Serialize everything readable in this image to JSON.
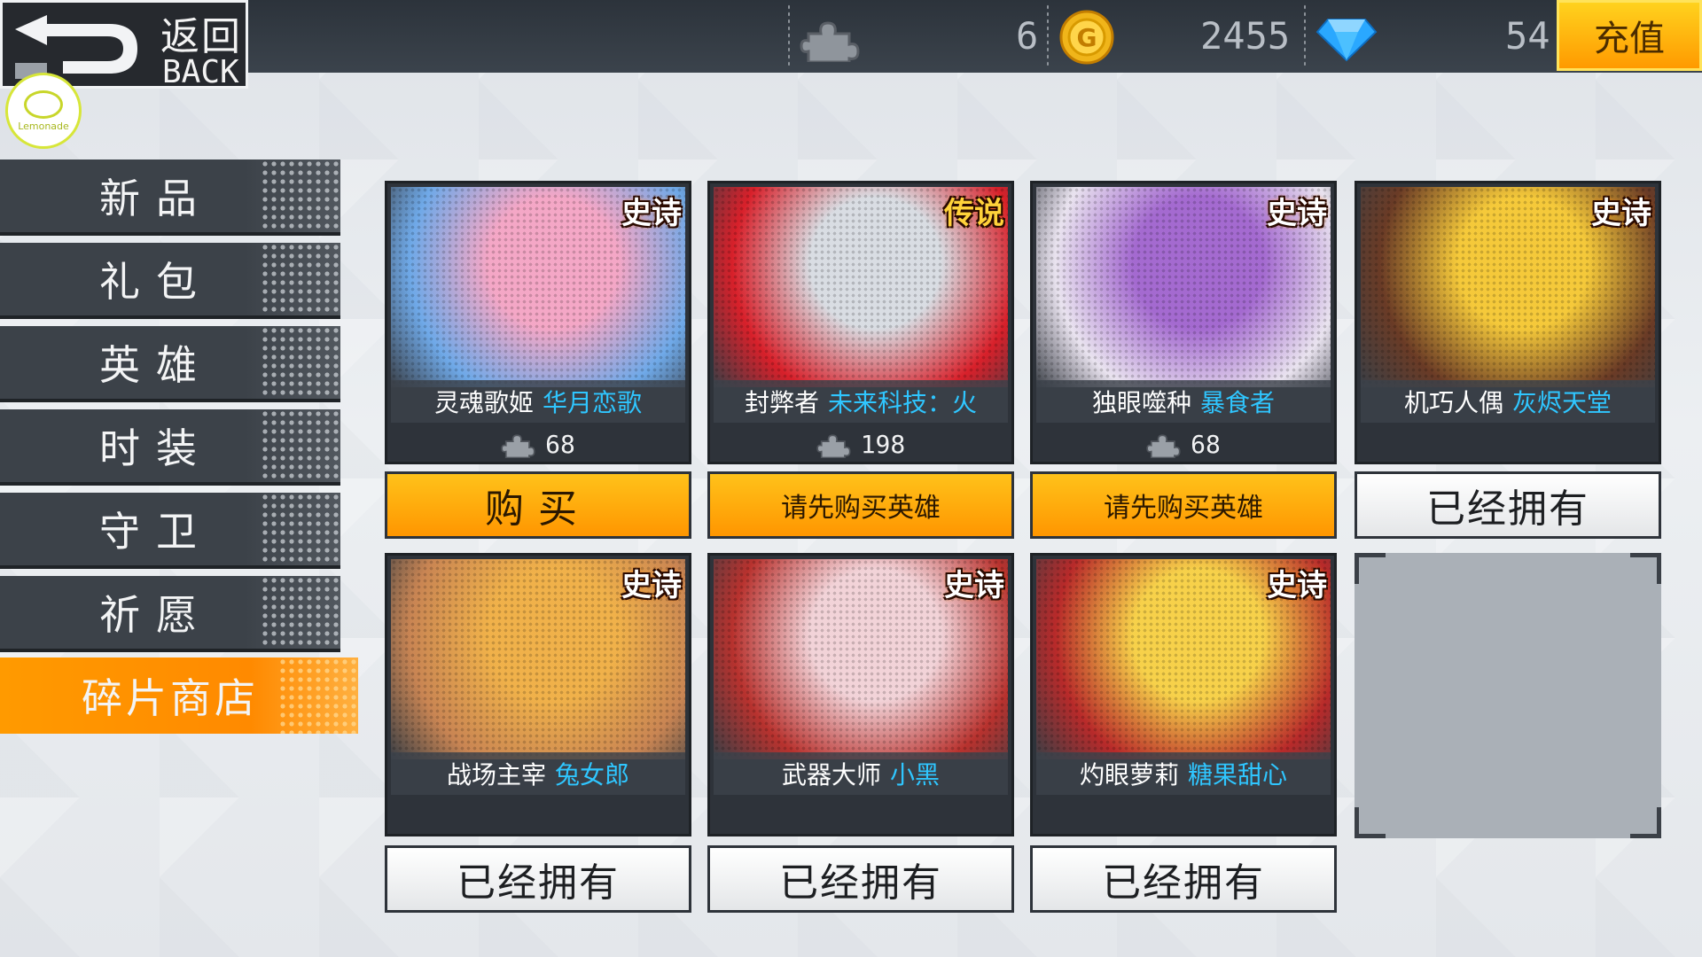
{
  "header": {
    "back_cn": "返回",
    "back_en": "BACK",
    "logo_text": "Lemonade",
    "shards_icon": "puzzle-piece-icon",
    "gold_value": "6",
    "gold_icon": "gold-coin-icon",
    "gem_value": "2455",
    "gem_icon": "diamond-icon",
    "extra_value": "54",
    "recharge_label": "充值"
  },
  "sidebar": {
    "items": [
      {
        "label": "新品",
        "active": false
      },
      {
        "label": "礼包",
        "active": false
      },
      {
        "label": "英雄",
        "active": false
      },
      {
        "label": "时装",
        "active": false
      },
      {
        "label": "守卫",
        "active": false
      },
      {
        "label": "祈愿",
        "active": false
      },
      {
        "label": "碎片商店",
        "active": true
      }
    ]
  },
  "cards": [
    {
      "rarity": "史诗",
      "hero": "灵魂歌姬",
      "skin": "华月恋歌",
      "price": "68",
      "button": "购买",
      "state": "buy",
      "colors": [
        "#f4a7c6",
        "#6fa9e8"
      ]
    },
    {
      "rarity": "传说",
      "hero": "封弊者",
      "skin": "未来科技：火",
      "price": "198",
      "button": "请先购买英雄",
      "state": "require",
      "colors": [
        "#d9dde3",
        "#d8202a"
      ]
    },
    {
      "rarity": "史诗",
      "hero": "独眼噬种",
      "skin": "暴食者",
      "price": "68",
      "button": "请先购买英雄",
      "state": "require",
      "colors": [
        "#a46ad0",
        "#e9e3ef"
      ]
    },
    {
      "rarity": "史诗",
      "hero": "机巧人偶",
      "skin": "灰烬天堂",
      "price": "",
      "button": "已经拥有",
      "state": "owned",
      "colors": [
        "#f5c93a",
        "#6a3b26"
      ]
    },
    {
      "rarity": "史诗",
      "hero": "战场主宰",
      "skin": "兔女郎",
      "price": "",
      "button": "已经拥有",
      "state": "owned",
      "colors": [
        "#f0b14a",
        "#c98553"
      ]
    },
    {
      "rarity": "史诗",
      "hero": "武器大师",
      "skin": "小黑",
      "price": "",
      "button": "已经拥有",
      "state": "owned",
      "colors": [
        "#f2d3d8",
        "#b8322e"
      ]
    },
    {
      "rarity": "史诗",
      "hero": "灼眼萝莉",
      "skin": "糖果甜心",
      "price": "",
      "button": "已经拥有",
      "state": "owned",
      "colors": [
        "#f7d14a",
        "#b82a2a"
      ]
    }
  ]
}
